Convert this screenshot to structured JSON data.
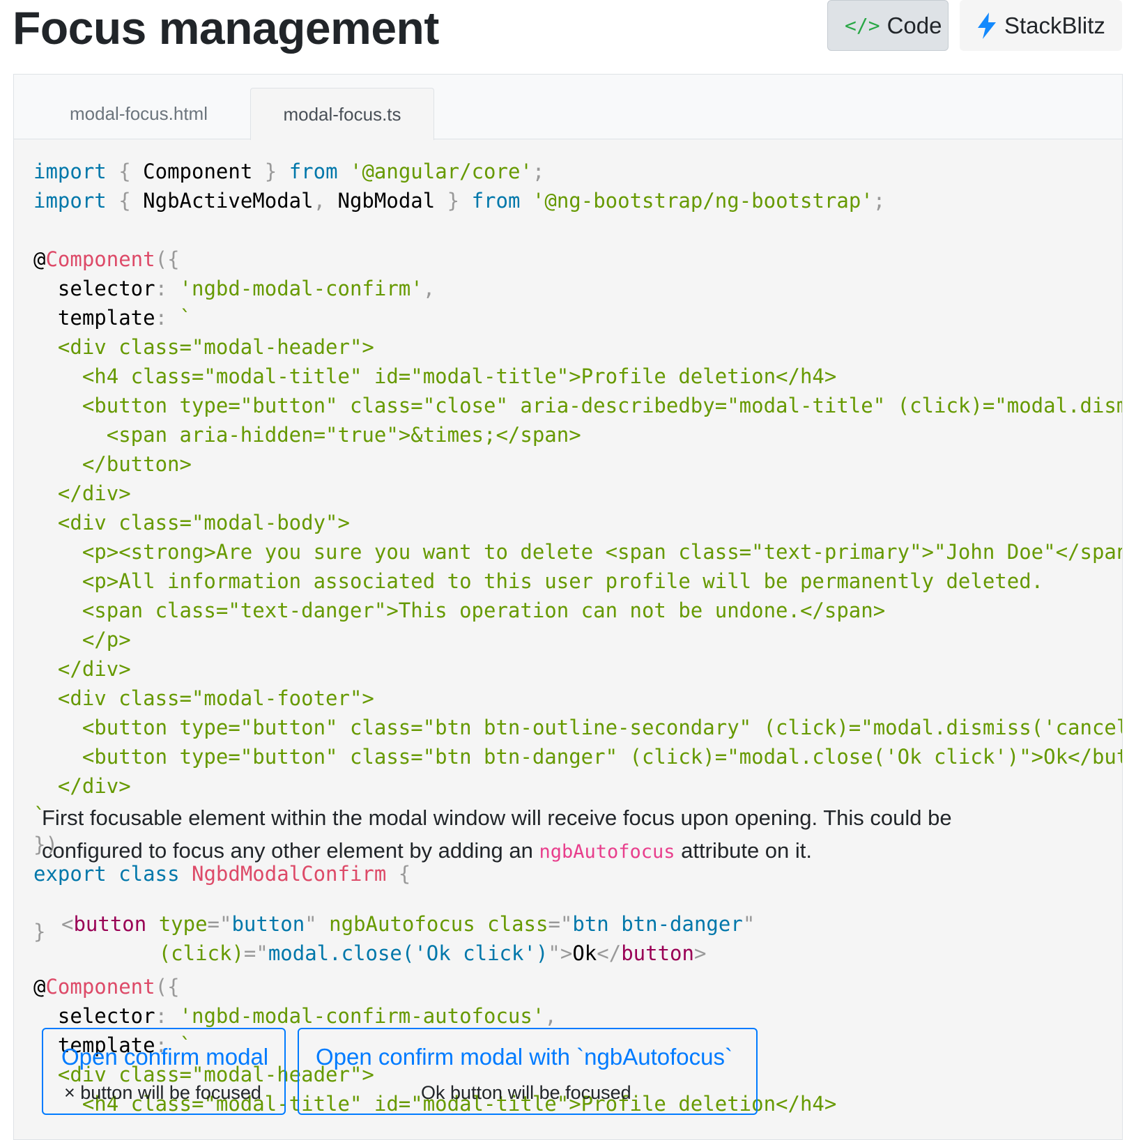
{
  "header": {
    "title": "Focus management",
    "code_button": {
      "icon": "code-icon",
      "icon_glyph": "</>",
      "label": "Code"
    },
    "stackblitz_button": {
      "icon": "lightning-bolt-icon",
      "label": "StackBlitz"
    }
  },
  "tabs": [
    {
      "label": "modal-focus.html",
      "active": false
    },
    {
      "label": "modal-focus.ts",
      "active": true
    }
  ],
  "code": {
    "l1": {
      "kw1": "import",
      "p1": " { ",
      "id": "Component",
      "p2": " } ",
      "kw2": "from",
      "s": " '@angular/core'",
      "p3": ";"
    },
    "l2": {
      "kw1": "import",
      "p1": " { ",
      "id1": "NgbActiveModal",
      "p2": ", ",
      "id2": "NgbModal",
      "p3": " } ",
      "kw2": "from",
      "s": " '@ng-bootstrap/ng-bootstrap'",
      "p4": ";"
    },
    "l4": {
      "at": "@",
      "fn": "Component",
      "p": "({"
    },
    "l5": {
      "key": "  selector",
      "p1": ": ",
      "s": "'ngbd-modal-confirm'",
      "p2": ","
    },
    "l6": {
      "key": "  template",
      "p1": ": ",
      "s": "`"
    },
    "template_lines": [
      "  <div class=\"modal-header\">",
      "    <h4 class=\"modal-title\" id=\"modal-title\">Profile deletion</h4>",
      "    <button type=\"button\" class=\"close\" aria-describedby=\"modal-title\" (click)=\"modal.dismiss",
      "      <span aria-hidden=\"true\">&times;</span>",
      "    </button>",
      "  </div>",
      "  <div class=\"modal-body\">",
      "    <p><strong>Are you sure you want to delete <span class=\"text-primary\">\"John Doe\"</span> p",
      "    <p>All information associated to this user profile will be permanently deleted.",
      "    <span class=\"text-danger\">This operation can not be undone.</span>",
      "    </p>",
      "  </div>",
      "  <div class=\"modal-footer\">",
      "    <button type=\"button\" class=\"btn btn-outline-secondary\" (click)=\"modal.dismiss('cancel cl",
      "    <button type=\"button\" class=\"btn btn-danger\" (click)=\"modal.close('Ok click')\">Ok</button",
      "  </div>"
    ],
    "backtick": "`",
    "close_obj": "})",
    "export": {
      "kw1": "export",
      "kw2": " class",
      "name": " NgbdModalConfirm",
      "p": " {"
    }
  },
  "description": {
    "text_before": "First focusable element within the modal window will receive focus upon opening. This could be configured to focus any other element by adding an ",
    "code": "ngbAutofocus",
    "text_after": " attribute on it."
  },
  "snippet": {
    "lt": "<",
    "tag": "button",
    "attr1": " type",
    "eq1": "=\"",
    "val1": "button",
    "q1": "\"",
    "attr2": " ngbAutofocus",
    "attr3": " class",
    "eq2": "=\"",
    "val2": "btn btn-danger",
    "q2": "\"",
    "indent": "        ",
    "attr4": "(click)",
    "eq3": "=\"",
    "val3": "modal.close('Ok click')",
    "q3": "\"",
    "gt": ">",
    "text": "Ok",
    "lt2": "</",
    "tag2": "button",
    "gt2": ">"
  },
  "closing_brace": "}",
  "code2": {
    "l1": {
      "at": "@",
      "fn": "Component",
      "p": "({"
    },
    "l2": {
      "key": "  selector",
      "p1": ": ",
      "s": "'ngbd-modal-confirm-autofocus'",
      "p2": ","
    },
    "l3": {
      "key": "  template",
      "p1": ": ",
      "s": "`"
    },
    "l4": "  <div class=\"modal-header\">",
    "l5": "    <h4 class=\"modal-title\" id=\"modal-title\">Profile deletion</h4>"
  },
  "demo": {
    "button1": {
      "label": "Open confirm modal",
      "hint": "× button will be focused"
    },
    "button2": {
      "label": "Open confirm modal with `ngbAutofocus`",
      "hint": "Ok button will be focused"
    }
  }
}
